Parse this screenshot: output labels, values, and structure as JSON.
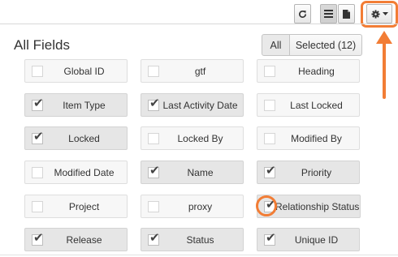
{
  "toolbar": {
    "refresh_icon": "refresh-icon",
    "list_icon": "list-view-icon",
    "document_icon": "document-icon",
    "gear_icon": "gear-icon",
    "accent_color": "#f27d35"
  },
  "header": {
    "title": "All Fields",
    "filter_all": "All",
    "filter_selected": "Selected (12)"
  },
  "fields": [
    {
      "label": "Global ID",
      "checked": false
    },
    {
      "label": "gtf",
      "checked": false
    },
    {
      "label": "Heading",
      "checked": false
    },
    {
      "label": "Item Type",
      "checked": true
    },
    {
      "label": "Last Activity Date",
      "checked": true
    },
    {
      "label": "Last Locked",
      "checked": false
    },
    {
      "label": "Locked",
      "checked": true
    },
    {
      "label": "Locked By",
      "checked": false
    },
    {
      "label": "Modified By",
      "checked": false
    },
    {
      "label": "Modified Date",
      "checked": false
    },
    {
      "label": "Name",
      "checked": true
    },
    {
      "label": "Priority",
      "checked": true
    },
    {
      "label": "Project",
      "checked": false
    },
    {
      "label": "proxy",
      "checked": false
    },
    {
      "label": "Relationship Status",
      "checked": true
    },
    {
      "label": "Release",
      "checked": true
    },
    {
      "label": "Status",
      "checked": true
    },
    {
      "label": "Unique ID",
      "checked": true
    }
  ]
}
